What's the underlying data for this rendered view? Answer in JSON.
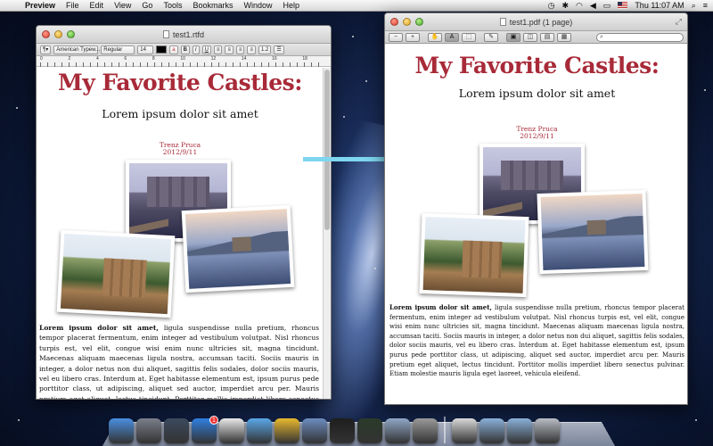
{
  "menubar": {
    "app_name": "Preview",
    "items": [
      "File",
      "Edit",
      "View",
      "Go",
      "Tools",
      "Bookmarks",
      "Window",
      "Help"
    ],
    "clock": "Thu 11:07 AM"
  },
  "textedit": {
    "title": "test1.rtfd",
    "toolbar": {
      "style": "¶▾",
      "font": "American Typew...",
      "weight": "Regular",
      "size": "14",
      "bold": "B",
      "italic": "I",
      "underline": "U",
      "spacing": "1.2",
      "list": "☰"
    },
    "ruler_numbers": [
      "0",
      "2",
      "4",
      "6",
      "8",
      "10",
      "12",
      "14",
      "16",
      "18"
    ]
  },
  "preview": {
    "title": "test1.pdf (1 page)",
    "search_placeholder": ""
  },
  "document": {
    "title": "My Favorite Castles:",
    "subtitle": "Lorem ipsum dolor sit amet",
    "author": "Trenz Pruca",
    "date": "2012/9/11",
    "body_lead": "Lorem ipsum dolor sit amet,",
    "te_body": "ligula suspendisse nulla pretium, rhoncus tempor placerat fermentum, enim integer ad vestibulum volutpat. Nisl rhoncus turpis est, vel elit, congue wisi enim nunc ultricies sit, magna tincidunt. Maecenas aliquam maecenas ligula nostra, accumsan taciti. Sociis mauris in integer, a dolor netus non dui aliquet, sagittis felis sodales, dolor sociis mauris, vel eu libero cras. Interdum at. Eget habitasse elementum est, ipsum purus pede porttitor class, ut adipiscing, aliquet sed auctor, imperdiet arcu per. Mauris pretium eget aliquet, lectus tincidunt. Porttitor mollis imperdiet libero senectus pulvinar. Etiam molestie mauris ligula eget",
    "pv_body": "ligula suspendisse nulla pretium, rhoncus tempor placerat fermentum, enim integer ad vestibulum volutpat. Nisl rhoncus turpis est, vel elit, congue wisi enim nunc ultricies sit, magna tincidunt. Maecenas aliquam maecenas ligula nostra, accumsan taciti. Sociis mauris in integer, a dolor netus non dui aliquet, sagittis felis sodales, dolor sociis mauris, vel eu libero cras. Interdum at. Eget habitasse elementum est, ipsum purus pede porttitor class, ut adipiscing, aliquet sed auctor, imperdiet arcu per. Mauris pretium eget aliquet, lectus tincidunt. Porttitor mollis imperdiet libero senectus pulvinar. Etiam molestie mauris ligula eget laoreet, vehicula eleifend."
  },
  "dock": {
    "items": [
      {
        "name": "finder-icon",
        "color": "#4a8fe0"
      },
      {
        "name": "launchpad-icon",
        "color": "#7a7f8a"
      },
      {
        "name": "mission-control-icon",
        "color": "#3b4a5e"
      },
      {
        "name": "app-store-icon",
        "color": "#2f7fe0",
        "badge": "1"
      },
      {
        "name": "textedit-icon",
        "color": "#e8e8e8"
      },
      {
        "name": "safari-icon",
        "color": "#5aa7e8"
      },
      {
        "name": "chrome-icon",
        "color": "#e8b92e"
      },
      {
        "name": "xcode-icon",
        "color": "#6c8cc0"
      },
      {
        "name": "terminal-icon",
        "color": "#1e1e1e"
      },
      {
        "name": "activity-monitor-icon",
        "color": "#2a3a2a"
      },
      {
        "name": "preview-icon",
        "color": "#8fa7c7"
      },
      {
        "name": "system-preferences-icon",
        "color": "#9a9a9a"
      },
      {
        "name": "pdf-document-icon",
        "color": "#d9d9d9"
      },
      {
        "name": "applications-folder-icon",
        "color": "#8ab0d8"
      },
      {
        "name": "downloads-folder-icon",
        "color": "#8ab0d8"
      },
      {
        "name": "trash-icon",
        "color": "#b8bcc4"
      }
    ]
  }
}
